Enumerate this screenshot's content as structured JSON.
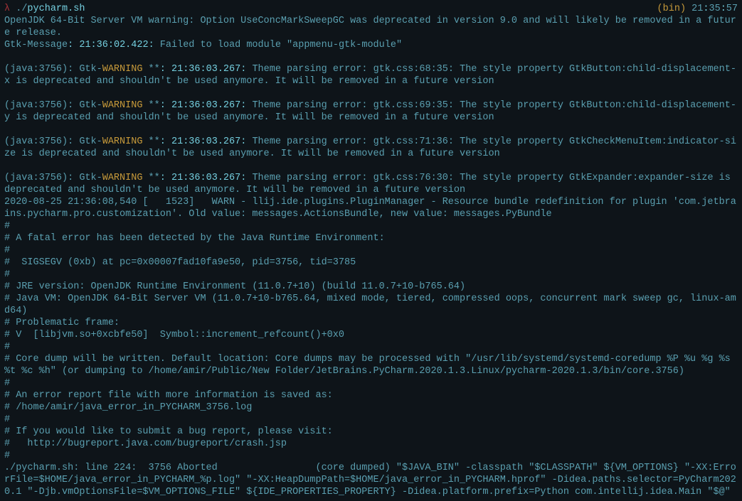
{
  "prompt": {
    "symbol": "λ",
    "cmd_prefix": "./",
    "cmd": "pycharm.sh",
    "paren_l": "(",
    "bin": "bin",
    "paren_r": ")",
    "clock": {
      "h": "21",
      "m": "35",
      "s": "57"
    }
  },
  "l1": "OpenJDK 64-Bit Server VM warning: Option UseConcMarkSweepGC was deprecated in version 9.0 and will likely be removed in a future release.",
  "gtk": {
    "label": "Gtk-Message",
    "ts": {
      "a": "21",
      "b": "36",
      "c": "02",
      "d": "422"
    },
    "rest": " Failed to load module \"appmenu-gtk-module\""
  },
  "w": [
    {
      "pre": "(java:3756): Gtk-",
      "warn": "WARNING",
      "stars": " **",
      "ts": {
        "a": "21",
        "b": "36",
        "c": "03",
        "d": "267"
      },
      "msg": " Theme parsing error: gtk.css:68:35: The style property GtkButton:child-displacement-x is deprecated and shouldn't be used anymore. It will be removed in a future version"
    },
    {
      "pre": "(java:3756): Gtk-",
      "warn": "WARNING",
      "stars": " **",
      "ts": {
        "a": "21",
        "b": "36",
        "c": "03",
        "d": "267"
      },
      "msg": " Theme parsing error: gtk.css:69:35: The style property GtkButton:child-displacement-y is deprecated and shouldn't be used anymore. It will be removed in a future version"
    },
    {
      "pre": "(java:3756): Gtk-",
      "warn": "WARNING",
      "stars": " **",
      "ts": {
        "a": "21",
        "b": "36",
        "c": "03",
        "d": "267"
      },
      "msg": " Theme parsing error: gtk.css:71:36: The style property GtkCheckMenuItem:indicator-size is deprecated and shouldn't be used anymore. It will be removed in a future version"
    },
    {
      "pre": "(java:3756): Gtk-",
      "warn": "WARNING",
      "stars": " **",
      "ts": {
        "a": "21",
        "b": "36",
        "c": "03",
        "d": "267"
      },
      "msg": " Theme parsing error: gtk.css:76:30: The style property GtkExpander:expander-size is deprecated and shouldn't be used anymore. It will be removed in a future version"
    }
  ],
  "plugin": "2020-08-25 21:36:08,540 [   1523]   WARN - llij.ide.plugins.PluginManager - Resource bundle redefinition for plugin 'com.jetbrains.pycharm.pro.customization'. Old value: messages.ActionsBundle, new value: messages.PyBundle",
  "crash": [
    "#",
    "# A fatal error has been detected by the Java Runtime Environment:",
    "#",
    "#  SIGSEGV (0xb) at pc=0x00007fad10fa9e50, pid=3756, tid=3785",
    "#",
    "# JRE version: OpenJDK Runtime Environment (11.0.7+10) (build 11.0.7+10-b765.64)",
    "# Java VM: OpenJDK 64-Bit Server VM (11.0.7+10-b765.64, mixed mode, tiered, compressed oops, concurrent mark sweep gc, linux-amd64)",
    "# Problematic frame:",
    "# V  [libjvm.so+0xcbfe50]  Symbol::increment_refcount()+0x0",
    "#",
    "# Core dump will be written. Default location: Core dumps may be processed with \"/usr/lib/systemd/systemd-coredump %P %u %g %s %t %c %h\" (or dumping to /home/amir/Public/New Folder/JetBrains.PyCharm.2020.1.3.Linux/pycharm-2020.1.3/bin/core.3756)",
    "#",
    "# An error report file with more information is saved as:",
    "# /home/amir/java_error_in_PYCHARM_3756.log",
    "#",
    "# If you would like to submit a bug report, please visit:",
    "#   http://bugreport.java.com/bugreport/crash.jsp",
    "#"
  ],
  "abort": "./pycharm.sh: line 224:  3756 Aborted                 (core dumped) \"$JAVA_BIN\" -classpath \"$CLASSPATH\" ${VM_OPTIONS} \"-XX:ErrorFile=$HOME/java_error_in_PYCHARM_%p.log\" \"-XX:HeapDumpPath=$HOME/java_error_in_PYCHARM.hprof\" -Didea.paths.selector=PyCharm2020.1 \"-Djb.vmOptionsFile=$VM_OPTIONS_FILE\" ${IDE_PROPERTIES_PROPERTY} -Didea.platform.prefix=Python com.intellij.idea.Main \"$@\""
}
